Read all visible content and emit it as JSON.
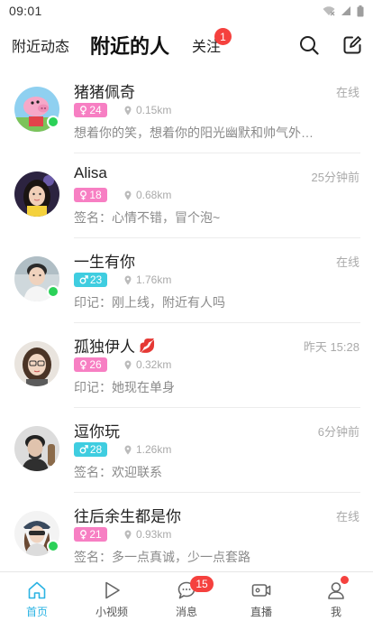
{
  "status_bar": {
    "time": "09:01"
  },
  "header": {
    "tab_dynamics": "附近动态",
    "tab_nearby": "附近的人",
    "tab_follow": "关注",
    "follow_badge": "1"
  },
  "users": [
    {
      "name": "猪猪佩奇",
      "status": "在线",
      "gender": "female",
      "age": "24",
      "distance": "0.15km",
      "signature": "想着你的笑，想着你的阳光幽默和帅气外…",
      "online": true,
      "emoji": ""
    },
    {
      "name": "Alisa",
      "status": "25分钟前",
      "gender": "female",
      "age": "18",
      "distance": "0.68km",
      "signature": "签名：心情不错，冒个泡~",
      "online": false,
      "emoji": ""
    },
    {
      "name": "一生有你",
      "status": "在线",
      "gender": "male",
      "age": "23",
      "distance": "1.76km",
      "signature": "印记：刚上线，附近有人吗",
      "online": true,
      "emoji": ""
    },
    {
      "name": "孤独伊人",
      "status": "昨天 15:28",
      "gender": "female",
      "age": "26",
      "distance": "0.32km",
      "signature": "印记：她现在单身",
      "online": false,
      "emoji": "💋"
    },
    {
      "name": "逗你玩",
      "status": "6分钟前",
      "gender": "male",
      "age": "28",
      "distance": "1.26km",
      "signature": "签名：欢迎联系",
      "online": false,
      "emoji": ""
    },
    {
      "name": "往后余生都是你",
      "status": "在线",
      "gender": "female",
      "age": "21",
      "distance": "0.93km",
      "signature": "签名：多一点真诚，少一点套路",
      "online": true,
      "emoji": ""
    }
  ],
  "bottom_nav": {
    "home": "首页",
    "video": "小视频",
    "messages": "消息",
    "messages_badge": "15",
    "live": "直播",
    "me": "我"
  },
  "colors": {
    "accent": "#2bb3e3",
    "female": "#f77fc3",
    "male": "#3fcde0",
    "online": "#2bd158",
    "badge": "#f5413e"
  }
}
